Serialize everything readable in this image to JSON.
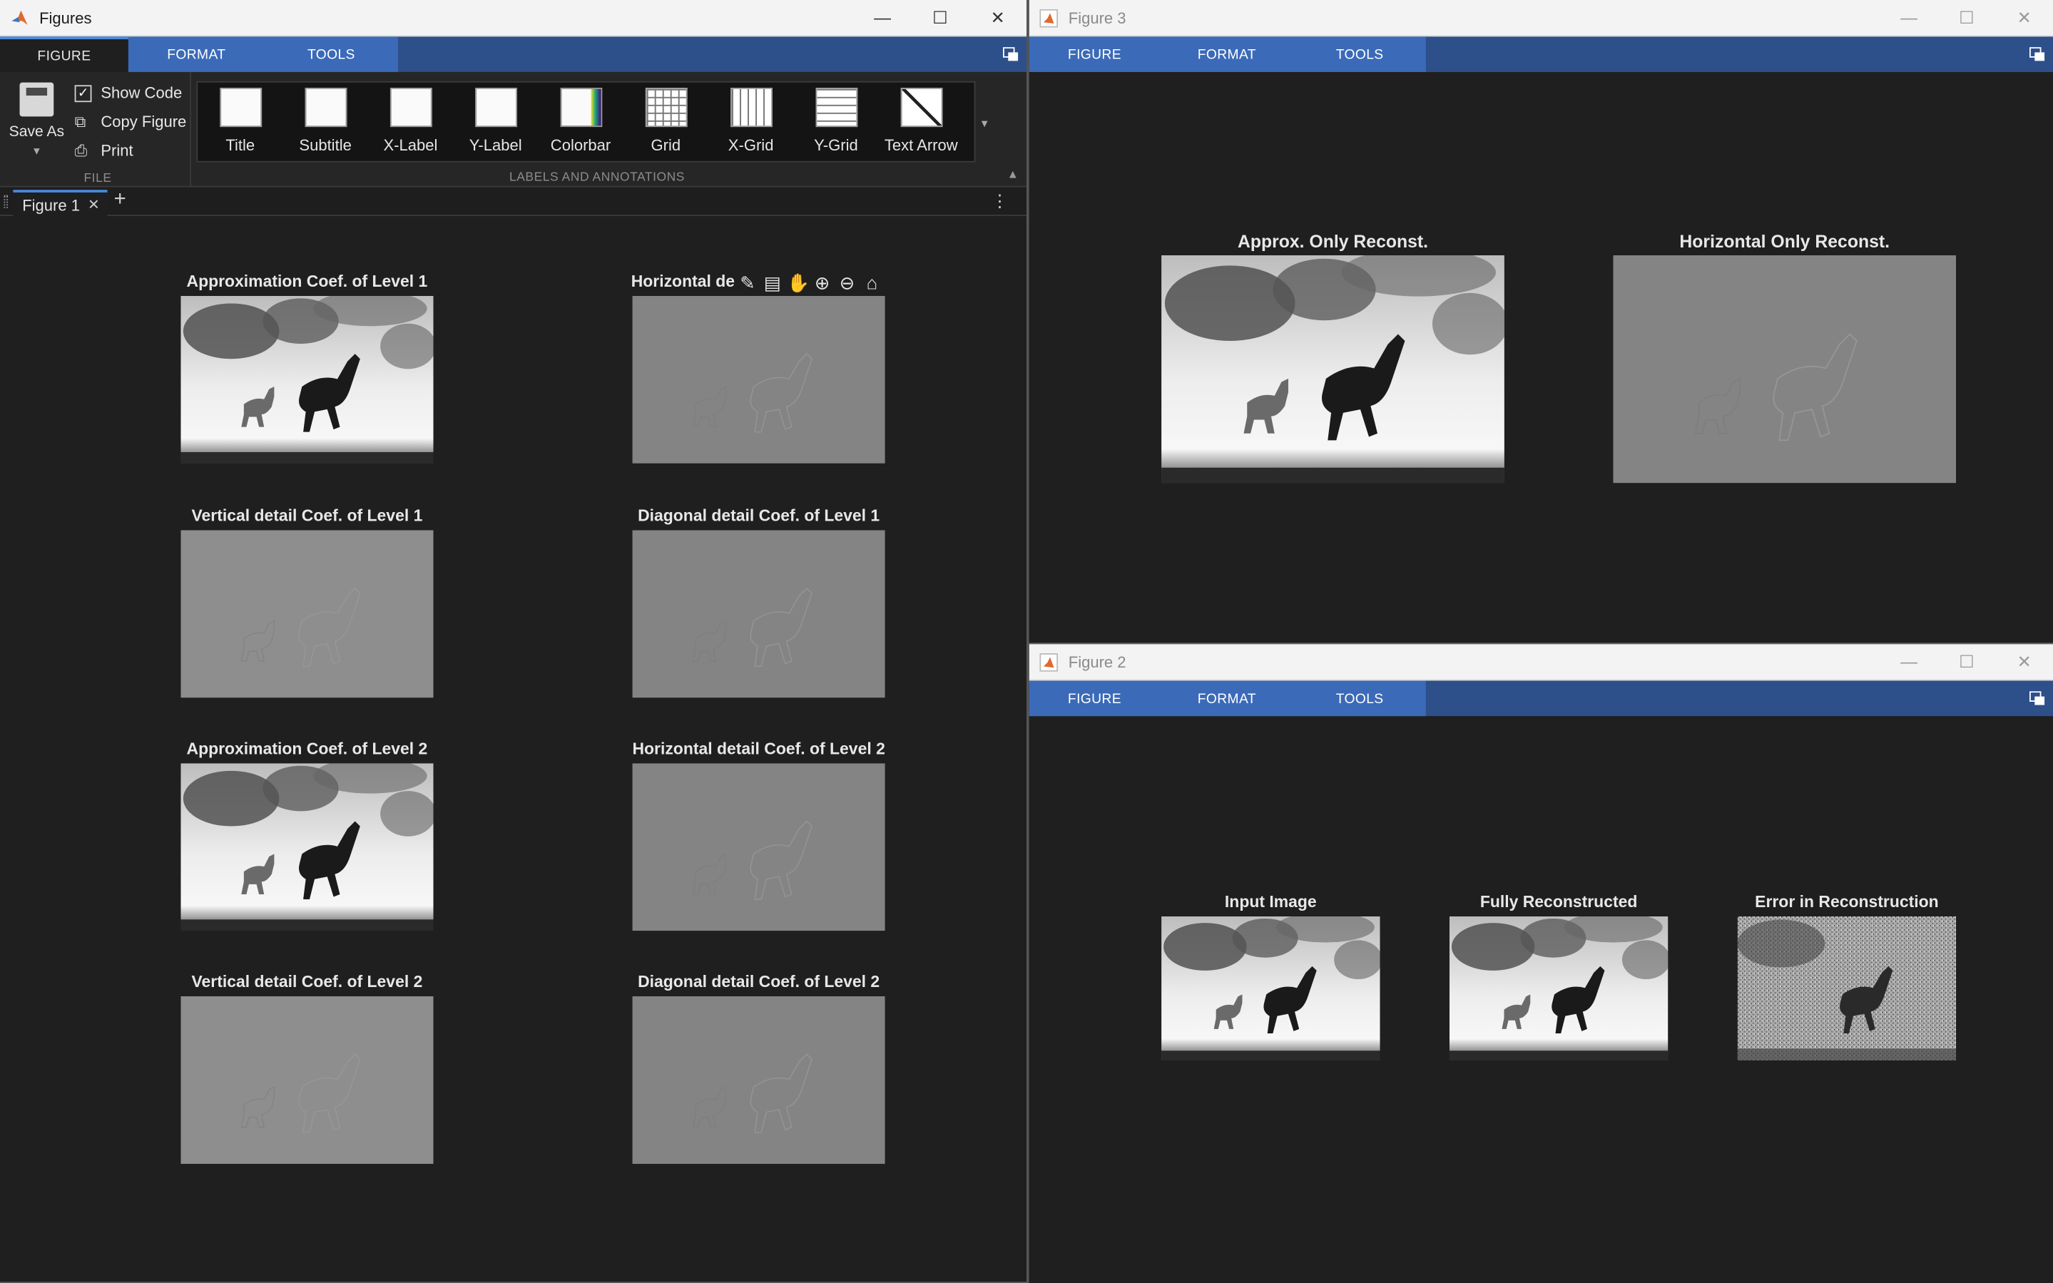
{
  "figures_window": {
    "title": "Figures",
    "tabs": [
      "FIGURE",
      "FORMAT",
      "TOOLS"
    ],
    "file_section": {
      "save_as": "Save As",
      "show_code": "Show Code",
      "copy_figure": "Copy Figure",
      "print": "Print",
      "label": "FILE"
    },
    "annotations_section": {
      "items": [
        "Title",
        "Subtitle",
        "X-Label",
        "Y-Label",
        "Colorbar",
        "Grid",
        "X-Grid",
        "Y-Grid",
        "Text Arrow"
      ],
      "label": "LABELS AND ANNOTATIONS"
    },
    "doc_tab": "Figure 1",
    "axes": [
      {
        "title": "Approximation Coef. of Level 1",
        "kind": "approx"
      },
      {
        "title": "Horizontal de",
        "kind": "detail"
      },
      {
        "title": "Vertical detail Coef. of Level 1",
        "kind": "detail-light"
      },
      {
        "title": "Diagonal detail Coef. of Level 1",
        "kind": "detail"
      },
      {
        "title": "Approximation Coef. of Level 2",
        "kind": "approx"
      },
      {
        "title": "Horizontal detail Coef. of Level 2",
        "kind": "detail"
      },
      {
        "title": "Vertical detail Coef. of Level 2",
        "kind": "detail-light"
      },
      {
        "title": "Diagonal detail Coef. of Level 2",
        "kind": "detail"
      }
    ]
  },
  "figure3": {
    "title": "Figure 3",
    "tabs": [
      "FIGURE",
      "FORMAT",
      "TOOLS"
    ],
    "axes": [
      {
        "title": "Approx. Only Reconst.",
        "kind": "approx"
      },
      {
        "title": "Horizontal Only Reconst.",
        "kind": "detail"
      }
    ]
  },
  "figure2": {
    "title": "Figure 2",
    "tabs": [
      "FIGURE",
      "FORMAT",
      "TOOLS"
    ],
    "axes": [
      {
        "title": "Input Image",
        "kind": "approx"
      },
      {
        "title": "Fully Reconstructed",
        "kind": "approx"
      },
      {
        "title": "Error in Reconstruction",
        "kind": "noise"
      }
    ]
  },
  "colors": {
    "background": "#1f1f1f",
    "tabstrip": "#2d4f8a",
    "tab_group": "#3b6ab8",
    "accent": "#4a8ae0",
    "detail_gray": "#858585"
  }
}
